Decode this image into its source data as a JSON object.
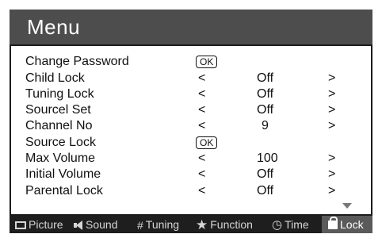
{
  "menu": {
    "title": "Menu",
    "rows": [
      {
        "label": "Change Password",
        "ok": "OK"
      },
      {
        "label": "Child Lock",
        "left": "<",
        "value": "Off",
        "right": ">"
      },
      {
        "label": "Tuning Lock",
        "left": "<",
        "value": "Off",
        "right": ">"
      },
      {
        "label": "Sourcel Set",
        "left": "<",
        "value": "Off",
        "right": ">"
      },
      {
        "label": "Channel No",
        "left": "<",
        "value": "9",
        "right": ">"
      },
      {
        "label": "Source Lock",
        "ok": "OK"
      },
      {
        "label": "Max Volume",
        "left": "<",
        "value": "100",
        "right": ">"
      },
      {
        "label": "Initial Volume",
        "left": "<",
        "value": "Off",
        "right": ">"
      },
      {
        "label": "Parental Lock",
        "left": "<",
        "value": "Off",
        "right": ">"
      }
    ],
    "scroll_indicator_icon": "down-triangle-icon"
  },
  "tabs": [
    {
      "label": "Picture",
      "icon": "monitor-icon"
    },
    {
      "label": "Sound",
      "icon": "speaker-icon"
    },
    {
      "label": "Tuning",
      "icon": "grid-icon",
      "glyph": "#"
    },
    {
      "label": "Function",
      "icon": "star-icon",
      "glyph": "★"
    },
    {
      "label": "Time",
      "icon": "clock-icon",
      "glyph": "◷"
    },
    {
      "label": "Lock",
      "icon": "lock-icon",
      "active": true
    }
  ],
  "colors": {
    "title_bar": "#4d4d4d",
    "frame": "#1c1c1c",
    "tab_bar": "#1e1e1e",
    "active_tab": "#5a5a5a"
  }
}
